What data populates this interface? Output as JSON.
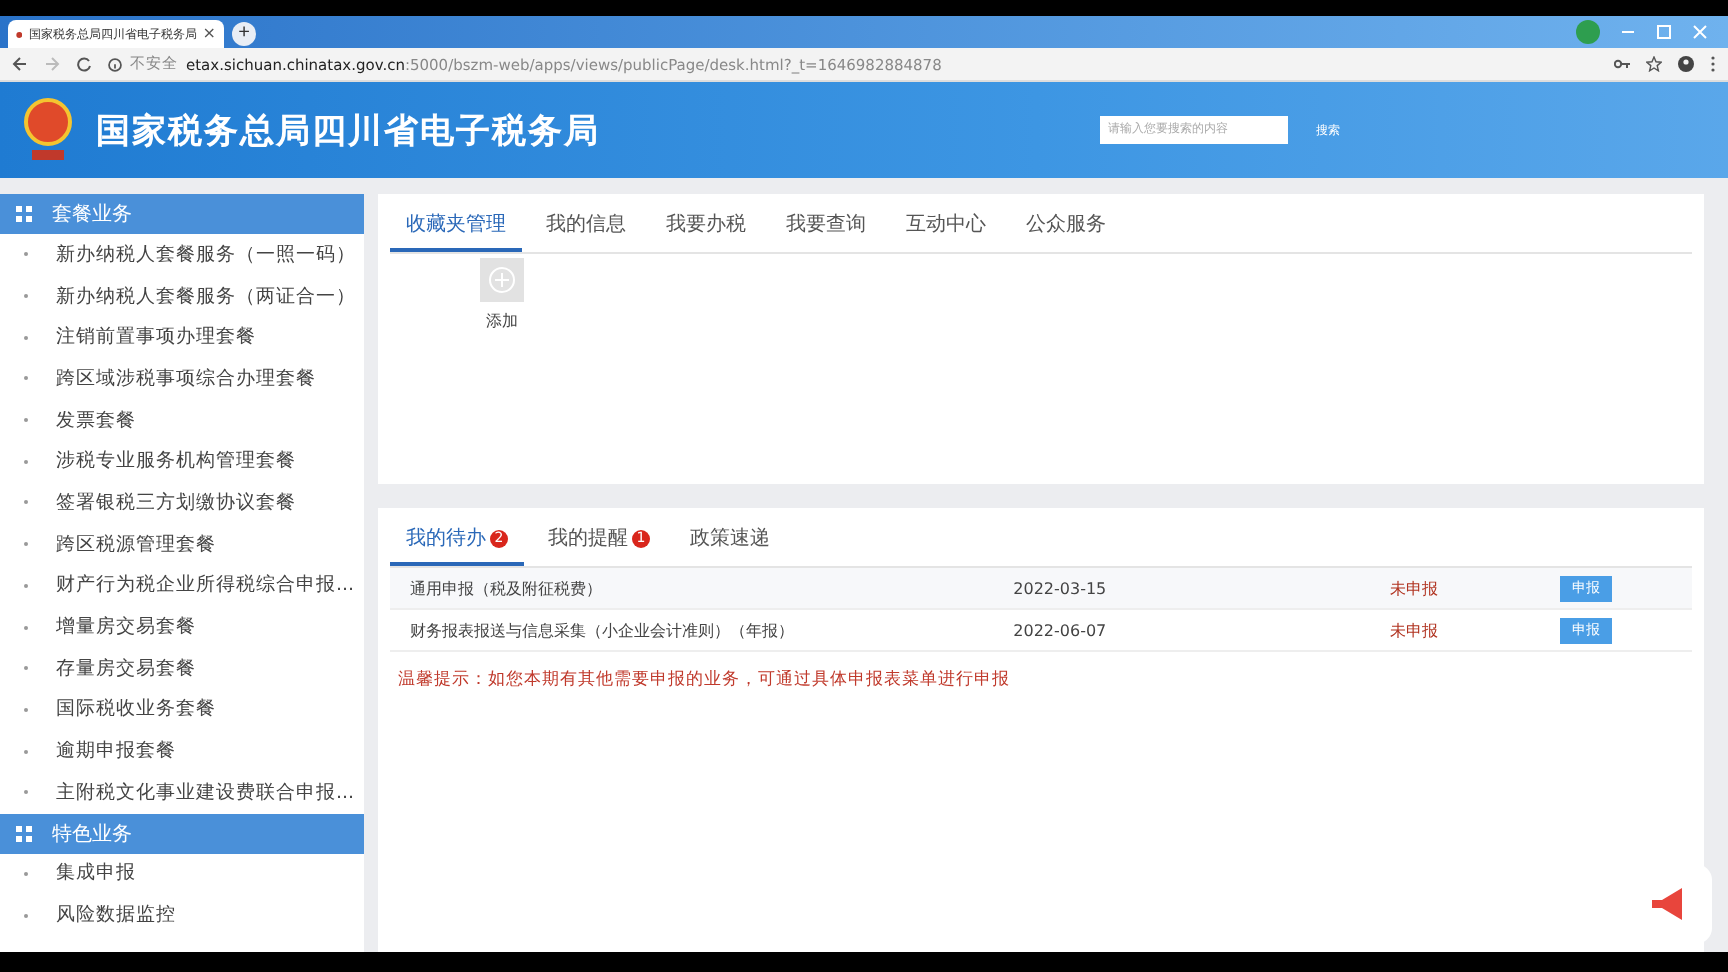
{
  "browser": {
    "tab_title": "国家税务总局四川省电子税务局",
    "tab_close": "×",
    "new_tab": "+",
    "security": "不安全",
    "url_host": "etax.sichuan.chinatax.gov.cn",
    "url_rest": ":5000/bszm-web/apps/views/publicPage/desk.html?_t=1646982884878"
  },
  "header": {
    "site_title": "国家税务总局四川省电子税务局",
    "search": {
      "placeholder": "请输入您要搜索的内容",
      "button": "搜索"
    }
  },
  "sidebar": [
    {
      "kind": "section",
      "label": "套餐业务",
      "selected": true
    },
    {
      "kind": "item",
      "label": "新办纳税人套餐服务（一照一码）"
    },
    {
      "kind": "item",
      "label": "新办纳税人套餐服务（两证合一）"
    },
    {
      "kind": "item",
      "label": "注销前置事项办理套餐"
    },
    {
      "kind": "item",
      "label": "跨区域涉税事项综合办理套餐"
    },
    {
      "kind": "item",
      "label": "发票套餐"
    },
    {
      "kind": "item",
      "label": "涉税专业服务机构管理套餐"
    },
    {
      "kind": "item",
      "label": "签署银税三方划缴协议套餐"
    },
    {
      "kind": "item",
      "label": "跨区税源管理套餐"
    },
    {
      "kind": "item",
      "label": "财产行为税企业所得税综合申报..."
    },
    {
      "kind": "item",
      "label": "增量房交易套餐"
    },
    {
      "kind": "item",
      "label": "存量房交易套餐"
    },
    {
      "kind": "item",
      "label": "国际税收业务套餐"
    },
    {
      "kind": "item",
      "label": "逾期申报套餐"
    },
    {
      "kind": "item",
      "label": "主附税文化事业建设费联合申报..."
    },
    {
      "kind": "section",
      "label": "特色业务",
      "selected": true
    },
    {
      "kind": "item",
      "label": "集成申报"
    },
    {
      "kind": "item",
      "label": "风险数据监控"
    }
  ],
  "top_tabs": [
    {
      "label": "收藏夹管理",
      "selected": true
    },
    {
      "label": "我的信息",
      "selected": false
    },
    {
      "label": "我要办税",
      "selected": false
    },
    {
      "label": "我要查询",
      "selected": false
    },
    {
      "label": "互动中心",
      "selected": false
    },
    {
      "label": "公众服务",
      "selected": false
    }
  ],
  "favorites": [
    {
      "label": "添加"
    }
  ],
  "bottom_tabs": [
    {
      "label": "我的待办",
      "badge": "2",
      "selected": true
    },
    {
      "label": "我的提醒",
      "badge": "1",
      "selected": false
    },
    {
      "label": "政策速递",
      "selected": false
    }
  ],
  "todo_rows": [
    {
      "name": "通用申报（税及附征税费）",
      "date": "2022-03-15",
      "status": "未申报",
      "action": "申报"
    },
    {
      "name": "财务报表报送与信息采集（小企业会计准则）（年报）",
      "date": "2022-06-07",
      "status": "未申报",
      "action": "申报"
    }
  ],
  "notice": "温馨提示：如您本期有其他需要申报的业务，可通过具体申报表菜单进行申报"
}
